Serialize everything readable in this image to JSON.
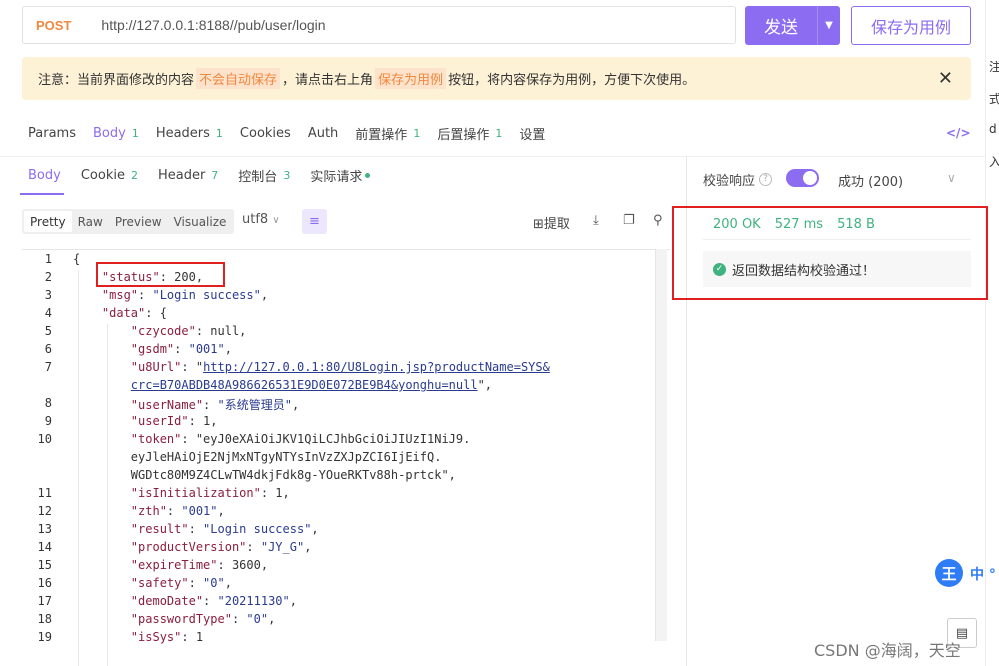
{
  "request": {
    "method": "POST",
    "url": "http://127.0.0.1:8188//pub/user/login",
    "send_label": "发送",
    "save_label": "保存为用例"
  },
  "notice": {
    "prefix": "注意：当前界面修改的内容",
    "hl1": "不会自动保存",
    "mid": "，请点击右上角",
    "hl2": "保存为用例",
    "suffix": "按钮，将内容保存为用例，方便下次使用。"
  },
  "request_tabs": [
    {
      "label": "Params",
      "count": ""
    },
    {
      "label": "Body",
      "count": "1"
    },
    {
      "label": "Headers",
      "count": "1"
    },
    {
      "label": "Cookies",
      "count": ""
    },
    {
      "label": "Auth",
      "count": ""
    },
    {
      "label": "前置操作",
      "count": "1"
    },
    {
      "label": "后置操作",
      "count": "1"
    },
    {
      "label": "设置",
      "count": ""
    }
  ],
  "response_tabs": [
    {
      "label": "Body",
      "count": ""
    },
    {
      "label": "Cookie",
      "count": "2"
    },
    {
      "label": "Header",
      "count": "7"
    },
    {
      "label": "控制台",
      "count": "3"
    },
    {
      "label": "实际请求",
      "count": ""
    }
  ],
  "toolbar": {
    "views": [
      "Pretty",
      "Raw",
      "Preview",
      "Visualize"
    ],
    "encoding": "utf8",
    "extract_label": "提取"
  },
  "code_lines": [
    {
      "n": "1",
      "text": "{"
    },
    {
      "n": "2",
      "text": "    \"status\": 200,"
    },
    {
      "n": "3",
      "text": "    \"msg\": \"Login success\","
    },
    {
      "n": "4",
      "text": "    \"data\": {"
    },
    {
      "n": "5",
      "text": "        \"czycode\": null,"
    },
    {
      "n": "6",
      "text": "        \"gsdm\": \"001\","
    },
    {
      "n": "7",
      "text": "        \"u8Url\": \"http://127.0.0.1:80/U8Login.jsp?productName=SYS&"
    },
    {
      "n": "",
      "text": "        crc=B70ABDB48A986626531E9D0E072BE9B4&yonghu=null\","
    },
    {
      "n": "8",
      "text": "        \"userName\": \"系统管理员\","
    },
    {
      "n": "9",
      "text": "        \"userId\": 1,"
    },
    {
      "n": "10",
      "text": "        \"token\": \"eyJ0eXAiOiJKV1QiLCJhbGciOiJIUzI1NiJ9."
    },
    {
      "n": "",
      "text": "        eyJleHAiOjE2NjMxNTgyNTYsInVzZXJpZCI6IjEifQ."
    },
    {
      "n": "",
      "text": "        WGDtc80M9Z4CLwTW4dkjFdk8g-YOueRKTv88h-prtck\","
    },
    {
      "n": "11",
      "text": "        \"isInitialization\": 1,"
    },
    {
      "n": "12",
      "text": "        \"zth\": \"001\","
    },
    {
      "n": "13",
      "text": "        \"result\": \"Login success\","
    },
    {
      "n": "14",
      "text": "        \"productVersion\": \"JY_G\","
    },
    {
      "n": "15",
      "text": "        \"expireTime\": 3600,"
    },
    {
      "n": "16",
      "text": "        \"safety\": \"0\","
    },
    {
      "n": "17",
      "text": "        \"demoDate\": \"20211130\","
    },
    {
      "n": "18",
      "text": "        \"passwordType\": \"0\","
    },
    {
      "n": "19",
      "text": "        \"isSys\": 1"
    }
  ],
  "right_panel": {
    "validate_label": "校验响应",
    "status_text": "成功 (200)",
    "stat_status": "200 OK",
    "stat_time": "527 ms",
    "stat_size": "518 B",
    "pass_text": "返回数据结构校验通过！"
  },
  "edge_text": [
    "注",
    "式",
    "d",
    "入"
  ],
  "ime": {
    "icon": "王",
    "text": "中 °"
  },
  "watermark": "CSDN @海阔，天空"
}
